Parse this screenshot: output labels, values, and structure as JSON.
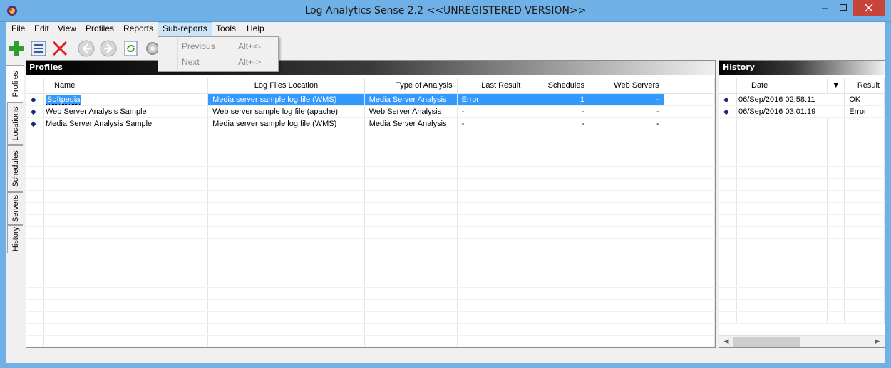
{
  "window": {
    "title": "Log Analytics Sense 2.2 <<UNREGISTERED VERSION>>",
    "colors": {
      "frame": "#6fb0e6",
      "close": "#c7443b",
      "selection": "#3399ff"
    }
  },
  "menu": [
    "File",
    "Edit",
    "View",
    "Profiles",
    "Reports",
    "Sub-reports",
    "Tools",
    "Help"
  ],
  "toolbar": {
    "icons": [
      "add-icon",
      "list-edit-icon",
      "delete-icon",
      "back-icon",
      "forward-icon",
      "refresh-icon",
      "gear-icon"
    ]
  },
  "submenu": {
    "items": [
      {
        "label": "Previous",
        "shortcut": "Alt+<-"
      },
      {
        "label": "Next",
        "shortcut": "Alt+->"
      }
    ]
  },
  "side_tabs": [
    "Profiles",
    "Locations",
    "Schedules",
    "Servers",
    "History"
  ],
  "profiles": {
    "title": "Profiles",
    "columns": [
      "Name",
      "Log Files Location",
      "Type of Analysis",
      "Last Result",
      "Schedules",
      "Web Servers"
    ],
    "rows": [
      {
        "name": "Softpedia",
        "location": "Media server sample log file (WMS)",
        "type": "Media Server Analysis",
        "result": "Error",
        "schedules": "1",
        "servers": "-"
      },
      {
        "name": "Web Server Analysis Sample",
        "location": "Web server sample log file (apache)",
        "type": "Web Server Analysis",
        "result": "-",
        "schedules": "-",
        "servers": "-"
      },
      {
        "name": "Media Server Analysis Sample",
        "location": "Media server sample log file (WMS)",
        "type": "Media Server Analysis",
        "result": "-",
        "schedules": "-",
        "servers": "-"
      }
    ]
  },
  "history": {
    "title": "History",
    "columns": [
      "Date",
      "Result"
    ],
    "sort_glyph": "▼",
    "rows": [
      {
        "date": "06/Sep/2016 02:58:11",
        "result": "OK"
      },
      {
        "date": "06/Sep/2016 03:01:19",
        "result": "Error"
      }
    ]
  }
}
